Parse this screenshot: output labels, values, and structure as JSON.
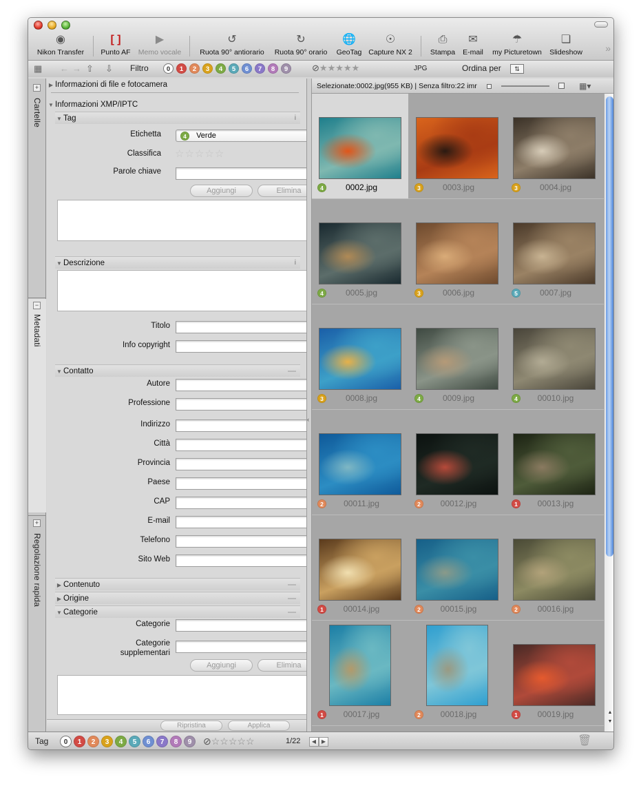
{
  "toolbar": {
    "nikon_transfer": "Nikon Transfer",
    "punto_af": "Punto AF",
    "memo_vocale": "Memo vocale",
    "ruota_anti": "Ruota 90° antiorario",
    "ruota_orario": "Ruota 90° orario",
    "geotag": "GeoTag",
    "capture_nx2": "Capture NX 2",
    "stampa": "Stampa",
    "email": "E-mail",
    "picturetown": "my Picturetown",
    "slideshow": "Slideshow"
  },
  "filterbar": {
    "label": "Filtro",
    "labels": [
      "0",
      "1",
      "2",
      "3",
      "4",
      "5",
      "6",
      "7",
      "8",
      "9"
    ],
    "format": "JPG",
    "sort_label": "Ordina per"
  },
  "label_colors": {
    "0": "#ffffff",
    "1": "#d24b45",
    "2": "#e1895a",
    "3": "#d9a21c",
    "4": "#7daa45",
    "5": "#5aa9b8",
    "6": "#6f8fd2",
    "7": "#8a78c8",
    "8": "#b27ab9",
    "9": "#9f8faa"
  },
  "side_tabs": {
    "folders": "Cartelle",
    "metadata": "Metadati",
    "quick_adjust": "Regolazione rapida"
  },
  "metadata": {
    "file_camera": "Informazioni di file e fotocamera",
    "xmp_iptc": "Informazioni XMP/IPTC",
    "tag": {
      "title": "Tag",
      "etichetta_label": "Etichetta",
      "etichetta_value": "Verde",
      "etichetta_num": "4",
      "classifica_label": "Classifica",
      "parole_label": "Parole chiave",
      "add": "Aggiungi",
      "remove": "Elimina"
    },
    "descrizione": {
      "title": "Descrizione",
      "titolo": "Titolo",
      "copyright": "Info copyright"
    },
    "contatto": {
      "title": "Contatto",
      "fields": [
        "Autore",
        "Professione",
        "Indirizzo",
        "Città",
        "Provincia",
        "Paese",
        "CAP",
        "E-mail",
        "Telefono",
        "Sito Web"
      ]
    },
    "contenuto": "Contenuto",
    "origine": "Origine",
    "categorie": {
      "title": "Categorie",
      "categorie_label": "Categorie",
      "supplementari_label_1": "Categorie",
      "supplementari_label_2": "supplementari",
      "add": "Aggiungi",
      "remove": "Elimina"
    },
    "footer": {
      "reset": "Ripristina",
      "apply": "Applica"
    }
  },
  "browser": {
    "status": "Selezionate:0002.jpg(955 KB) | Senza filtro:22 imr",
    "thumbnails": [
      {
        "name": "0002.jpg",
        "label": "4",
        "selected": true,
        "c1": "#1f7f8c",
        "c2": "#7fb8b0",
        "c3": "#e0561a"
      },
      {
        "name": "0003.jpg",
        "label": "3",
        "selected": false,
        "c1": "#d9641c",
        "c2": "#a93c14",
        "c3": "#2a1a12"
      },
      {
        "name": "0004.jpg",
        "label": "3",
        "selected": false,
        "c1": "#3b3228",
        "c2": "#8d7d68",
        "c3": "#d7ccb8"
      },
      {
        "name": "0005.jpg",
        "label": "4",
        "selected": false,
        "c1": "#1a2a30",
        "c2": "#5c6d6a",
        "c3": "#b08a56"
      },
      {
        "name": "0006.jpg",
        "label": "3",
        "selected": false,
        "c1": "#6e4a2e",
        "c2": "#b58358",
        "c3": "#d9ab78"
      },
      {
        "name": "0007.jpg",
        "label": "5",
        "selected": false,
        "c1": "#4b3a2a",
        "c2": "#9a8264",
        "c3": "#c8b392"
      },
      {
        "name": "0008.jpg",
        "label": "3",
        "selected": false,
        "c1": "#1a5fa8",
        "c2": "#3da0c8",
        "c3": "#e6b14a"
      },
      {
        "name": "0009.jpg",
        "label": "4",
        "selected": false,
        "c1": "#3f4a42",
        "c2": "#8a9488",
        "c3": "#b59a78"
      },
      {
        "name": "00010.jpg",
        "label": "4",
        "selected": false,
        "c1": "#49453a",
        "c2": "#8e8872",
        "c3": "#b2ab94"
      },
      {
        "name": "00011.jpg",
        "label": "2",
        "selected": false,
        "c1": "#0f5a9a",
        "c2": "#2c8dc3",
        "c3": "#7fb7c4"
      },
      {
        "name": "00012.jpg",
        "label": "2",
        "selected": false,
        "c1": "#0c1210",
        "c2": "#1f2a24",
        "c3": "#b64a3a"
      },
      {
        "name": "00013.jpg",
        "label": "1",
        "selected": false,
        "c1": "#1d2414",
        "c2": "#4f5c3a",
        "c3": "#8a7a60"
      },
      {
        "name": "00014.jpg",
        "label": "1",
        "selected": false,
        "c1": "#5a3a1c",
        "c2": "#c9a060",
        "c3": "#f1dfb0"
      },
      {
        "name": "00015.jpg",
        "label": "2",
        "selected": false,
        "c1": "#165f88",
        "c2": "#3a8ea6",
        "c3": "#8a9a8a"
      },
      {
        "name": "00016.jpg",
        "label": "2",
        "selected": false,
        "c1": "#4a4a36",
        "c2": "#8c8a62",
        "c3": "#b2a27a"
      },
      {
        "name": "00017.jpg",
        "label": "1",
        "selected": false,
        "portrait": true,
        "c1": "#1c7fa6",
        "c2": "#6ab8c2",
        "c3": "#b39a6a"
      },
      {
        "name": "00018.jpg",
        "label": "2",
        "selected": false,
        "portrait": true,
        "c1": "#2f9fd0",
        "c2": "#7fc6d8",
        "c3": "#9a9a82"
      },
      {
        "name": "00019.jpg",
        "label": "1",
        "selected": false,
        "c1": "#4a2a26",
        "c2": "#b04a3a",
        "c3": "#e55a2e"
      }
    ]
  },
  "statusbar": {
    "tag_label": "Tag",
    "page": "1/22"
  }
}
